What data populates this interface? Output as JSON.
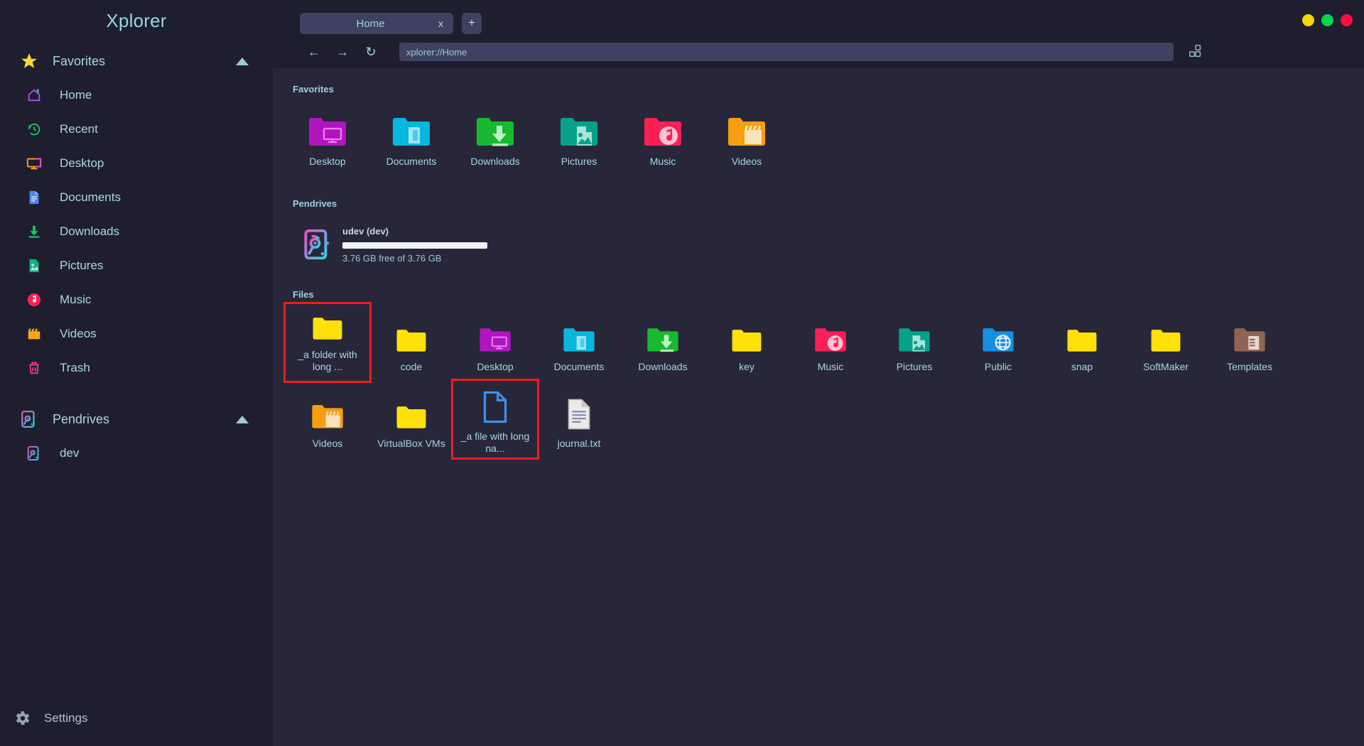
{
  "app": {
    "title": "Xplorer"
  },
  "window_controls": [
    {
      "name": "minimize",
      "color": "#f5d800"
    },
    {
      "name": "maximize",
      "color": "#00d64a"
    },
    {
      "name": "close",
      "color": "#fa0f3c"
    }
  ],
  "tabs": {
    "items": [
      {
        "label": "Home",
        "close": "x",
        "active": true
      }
    ],
    "new_tab_label": "+"
  },
  "nav": {
    "back": "←",
    "forward": "→",
    "reload": "↻",
    "url_value": "xplorer://Home",
    "url_placeholder": "xplorer://Home",
    "layout_icon": "grid-layout-icon"
  },
  "sidebar": {
    "sections": [
      {
        "label": "Favorites",
        "icon": "star-icon",
        "expanded": true,
        "caret": "triangle-up-icon",
        "items": [
          {
            "label": "Home",
            "icon": "home-icon"
          },
          {
            "label": "Recent",
            "icon": "history-icon"
          },
          {
            "label": "Desktop",
            "icon": "monitor-icon"
          },
          {
            "label": "Documents",
            "icon": "document-icon"
          },
          {
            "label": "Downloads",
            "icon": "download-icon"
          },
          {
            "label": "Pictures",
            "icon": "image-icon"
          },
          {
            "label": "Music",
            "icon": "music-icon"
          },
          {
            "label": "Videos",
            "icon": "clapperboard-icon"
          },
          {
            "label": "Trash",
            "icon": "trash-icon"
          }
        ]
      },
      {
        "label": "Pendrives",
        "icon": "harddrive-icon",
        "expanded": true,
        "caret": "triangle-up-icon",
        "items": [
          {
            "label": "dev",
            "icon": "harddrive-icon"
          }
        ]
      }
    ],
    "settings": {
      "label": "Settings",
      "icon": "gear-icon"
    }
  },
  "main": {
    "favorites": {
      "heading": "Favorites",
      "items": [
        {
          "label": "Desktop",
          "icon": "folder-desktop"
        },
        {
          "label": "Documents",
          "icon": "folder-documents"
        },
        {
          "label": "Downloads",
          "icon": "folder-downloads"
        },
        {
          "label": "Pictures",
          "icon": "folder-pictures"
        },
        {
          "label": "Music",
          "icon": "folder-music"
        },
        {
          "label": "Videos",
          "icon": "folder-videos"
        }
      ]
    },
    "pendrives": {
      "heading": "Pendrives",
      "drives": [
        {
          "name": "udev (dev)",
          "free_text": "3.76 GB free of 3.76 GB",
          "used_percent": 0,
          "icon": "harddrive-icon"
        }
      ]
    },
    "files": {
      "heading": "Files",
      "items": [
        {
          "label": "_a folder with long ...",
          "icon": "folder-plain",
          "highlighted": true
        },
        {
          "label": "code",
          "icon": "folder-plain",
          "highlighted": false
        },
        {
          "label": "Desktop",
          "icon": "folder-desktop",
          "highlighted": false
        },
        {
          "label": "Documents",
          "icon": "folder-documents",
          "highlighted": false
        },
        {
          "label": "Downloads",
          "icon": "folder-downloads",
          "highlighted": false
        },
        {
          "label": "key",
          "icon": "folder-plain",
          "highlighted": false
        },
        {
          "label": "Music",
          "icon": "folder-music",
          "highlighted": false
        },
        {
          "label": "Pictures",
          "icon": "folder-pictures",
          "highlighted": false
        },
        {
          "label": "Public",
          "icon": "folder-public",
          "highlighted": false
        },
        {
          "label": "snap",
          "icon": "folder-plain",
          "highlighted": false
        },
        {
          "label": "SoftMaker",
          "icon": "folder-plain",
          "highlighted": false
        },
        {
          "label": "Templates",
          "icon": "folder-templates",
          "highlighted": false
        },
        {
          "label": "Videos",
          "icon": "folder-videos",
          "highlighted": false
        },
        {
          "label": "VirtualBox VMs",
          "icon": "folder-plain",
          "highlighted": false
        },
        {
          "label": "_a file with long na...",
          "icon": "file-blank",
          "highlighted": true
        },
        {
          "label": "journal.txt",
          "icon": "file-text",
          "highlighted": false
        }
      ]
    }
  },
  "colors": {
    "sidebar_bg": "#1e1e2e",
    "content_bg": "#272739",
    "accent_text": "#a8d6e2",
    "highlight": "#f51b1b",
    "tab_bg": "#3e415f"
  }
}
